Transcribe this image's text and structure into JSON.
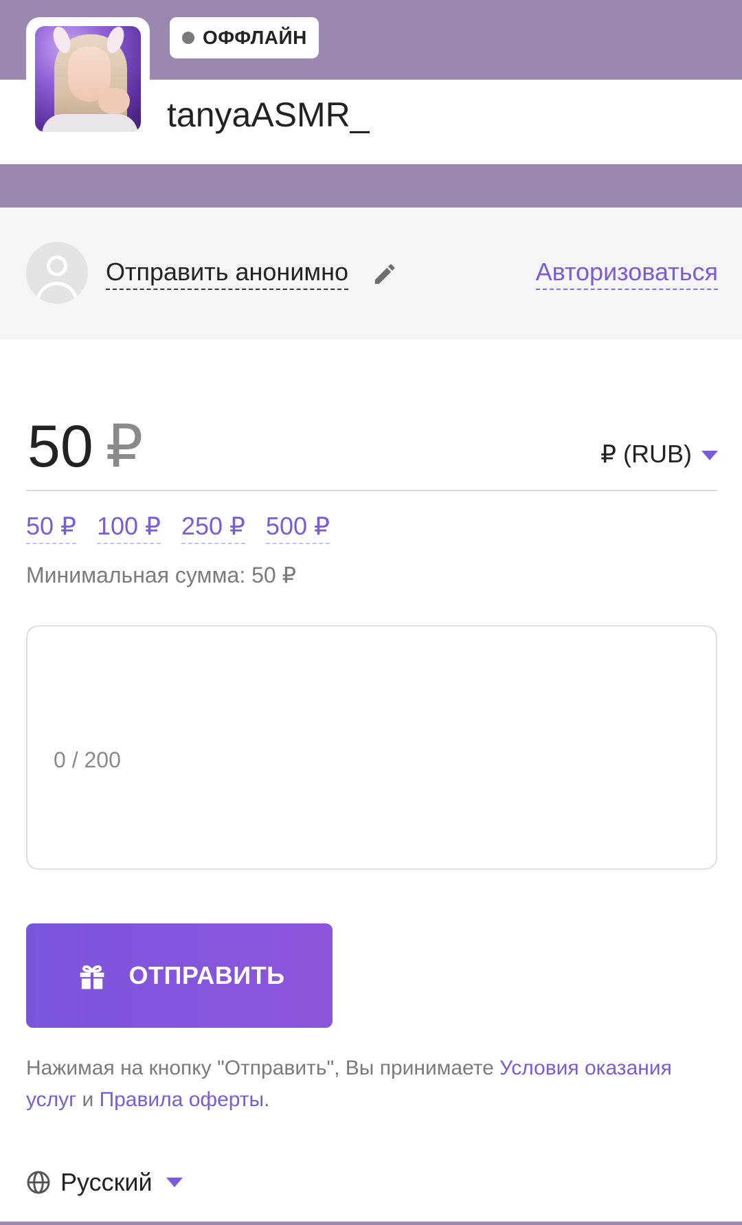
{
  "colors": {
    "banner": "#9a88b0",
    "accent": "#7b5bd6",
    "button": "#8155dc"
  },
  "header": {
    "status": "ОФФЛАЙН",
    "username": "tanyaASMR_",
    "avatar_icon": "streamer-avatar-photo"
  },
  "anon": {
    "label": "Отправить анонимно",
    "edit_icon": "pencil-icon",
    "login_link": "Авторизоваться"
  },
  "amount": {
    "value": "50",
    "symbol": "₽",
    "currency": "₽ (RUB)",
    "presets": [
      "50 ₽",
      "100 ₽",
      "250 ₽",
      "500 ₽"
    ],
    "min_text": "Минимальная сумма: 50 ₽"
  },
  "message": {
    "counter": "0 / 200"
  },
  "send": {
    "label": "ОТПРАВИТЬ",
    "icon": "gift-icon"
  },
  "terms": {
    "prefix": "Нажимая на кнопку \"Отправить\", Вы принимаете ",
    "link1": "Условия оказания услуг",
    "middle": " и ",
    "link2": "Правила оферты",
    "suffix": "."
  },
  "language": {
    "label": "Русский",
    "icon": "globe-icon"
  }
}
